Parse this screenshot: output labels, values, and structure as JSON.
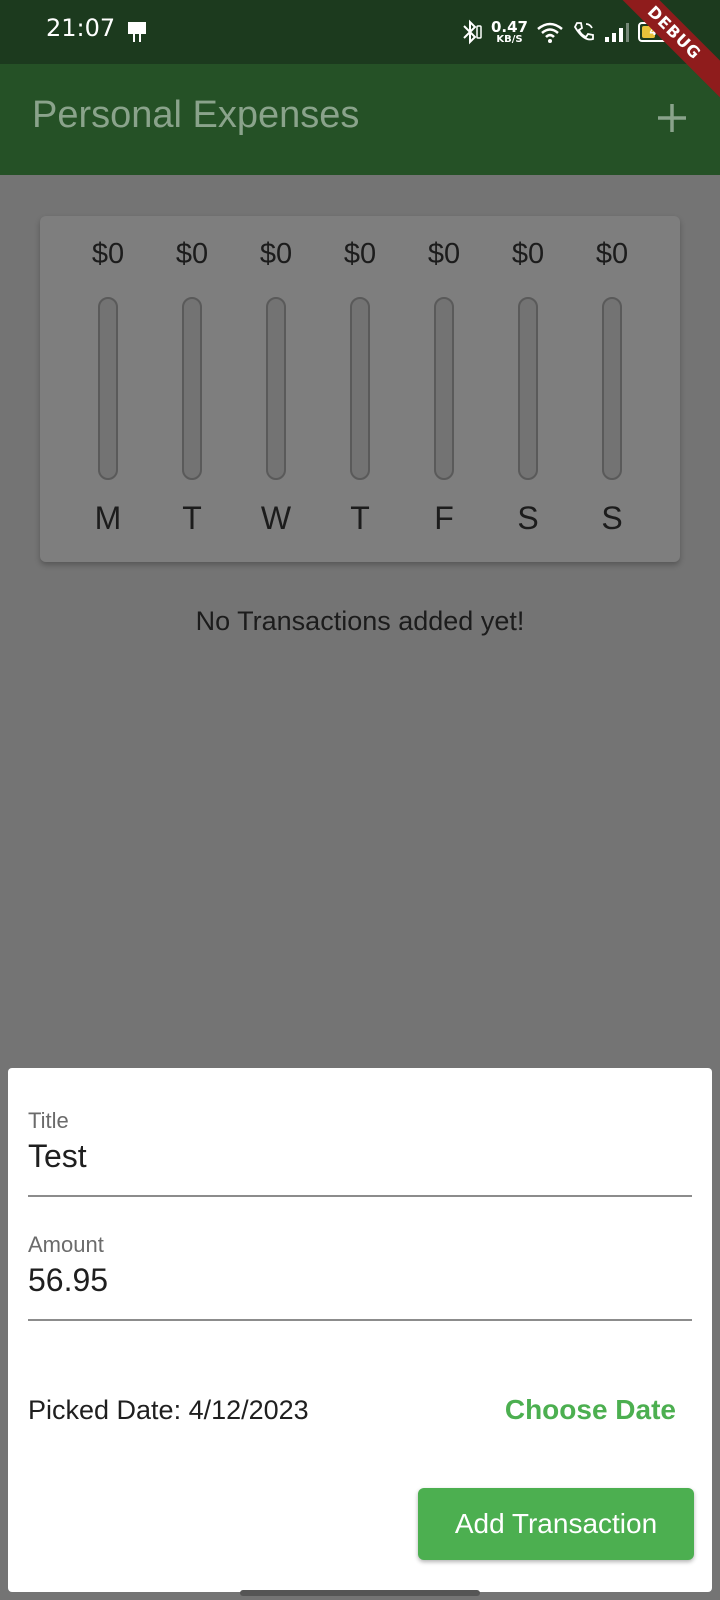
{
  "status_bar": {
    "time": "21:07",
    "net_speed_value": "0.47",
    "net_speed_unit": "KB/S",
    "battery_level": "42",
    "battery_fraction": 0.42
  },
  "debug_banner": "DEBUG",
  "app_bar": {
    "title": "Personal Expenses",
    "add_icon": "plus-icon"
  },
  "chart": {
    "bars": [
      {
        "amount": "$0",
        "day": "M",
        "fill": 0
      },
      {
        "amount": "$0",
        "day": "T",
        "fill": 0
      },
      {
        "amount": "$0",
        "day": "W",
        "fill": 0
      },
      {
        "amount": "$0",
        "day": "T",
        "fill": 0
      },
      {
        "amount": "$0",
        "day": "F",
        "fill": 0
      },
      {
        "amount": "$0",
        "day": "S",
        "fill": 0
      },
      {
        "amount": "$0",
        "day": "S",
        "fill": 0
      }
    ]
  },
  "empty_message": "No Transactions added yet!",
  "form": {
    "title_label": "Title",
    "title_value": "Test",
    "amount_label": "Amount",
    "amount_value": "56.95",
    "picked_date": "Picked Date: 4/12/2023",
    "choose_date_label": "Choose Date",
    "submit_label": "Add Transaction"
  },
  "colors": {
    "app_bar": "#255126",
    "accent": "#4caf50",
    "status_bar": "#1c3a1e",
    "scrim_background": "#747474"
  }
}
